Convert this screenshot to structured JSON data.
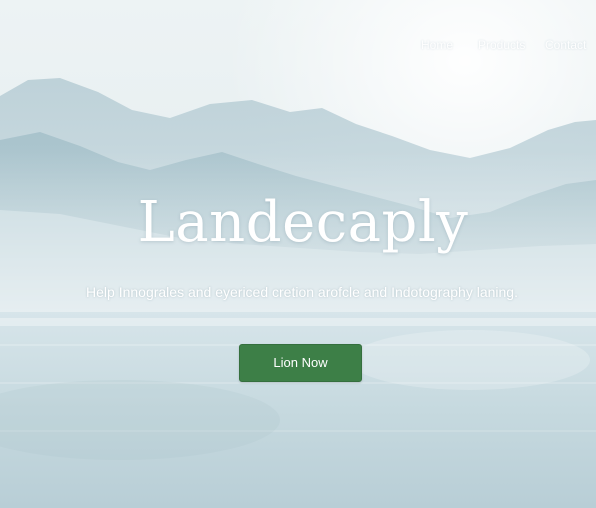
{
  "nav": {
    "items": [
      {
        "label": "Home"
      },
      {
        "label": "Products"
      },
      {
        "label": "Contact"
      }
    ]
  },
  "hero": {
    "title": "Landecaply",
    "subtitle": "Help Innograles and eyericed cretion arofcle and Indotography laning.",
    "cta_label": "Lion Now"
  },
  "colors": {
    "cta_background": "#3d7f47",
    "sky": "#e6eef0",
    "mountains": "#a9c3cc",
    "water": "#c9dbe1",
    "text": "#ffffff"
  }
}
